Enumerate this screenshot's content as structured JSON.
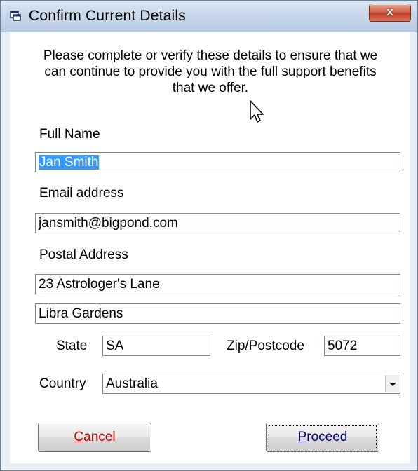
{
  "window": {
    "title": "Confirm Current Details",
    "close_label": "x"
  },
  "intro": {
    "text": "Please complete or verify these details to ensure that we can continue to provide you with the full support benefits that we offer."
  },
  "form": {
    "full_name_label": "Full Name",
    "full_name_value": "Jan Smith",
    "email_label": "Email address",
    "email_value": "jansmith@bigpond.com",
    "postal_label": "Postal Address",
    "address_line1": "23 Astrologer's Lane",
    "address_line2": "Libra Gardens",
    "state_label": "State",
    "state_value": "SA",
    "zip_label": "Zip/Postcode",
    "zip_value": "5072",
    "country_label": "Country",
    "country_value": "Australia"
  },
  "buttons": {
    "cancel_mnemonic": "C",
    "cancel_rest": "ancel",
    "proceed_mnemonic": "P",
    "proceed_rest": "roceed"
  },
  "colors": {
    "cancel_text": "#c00000",
    "proceed_text": "#00007f",
    "selection": "#3399ff"
  }
}
